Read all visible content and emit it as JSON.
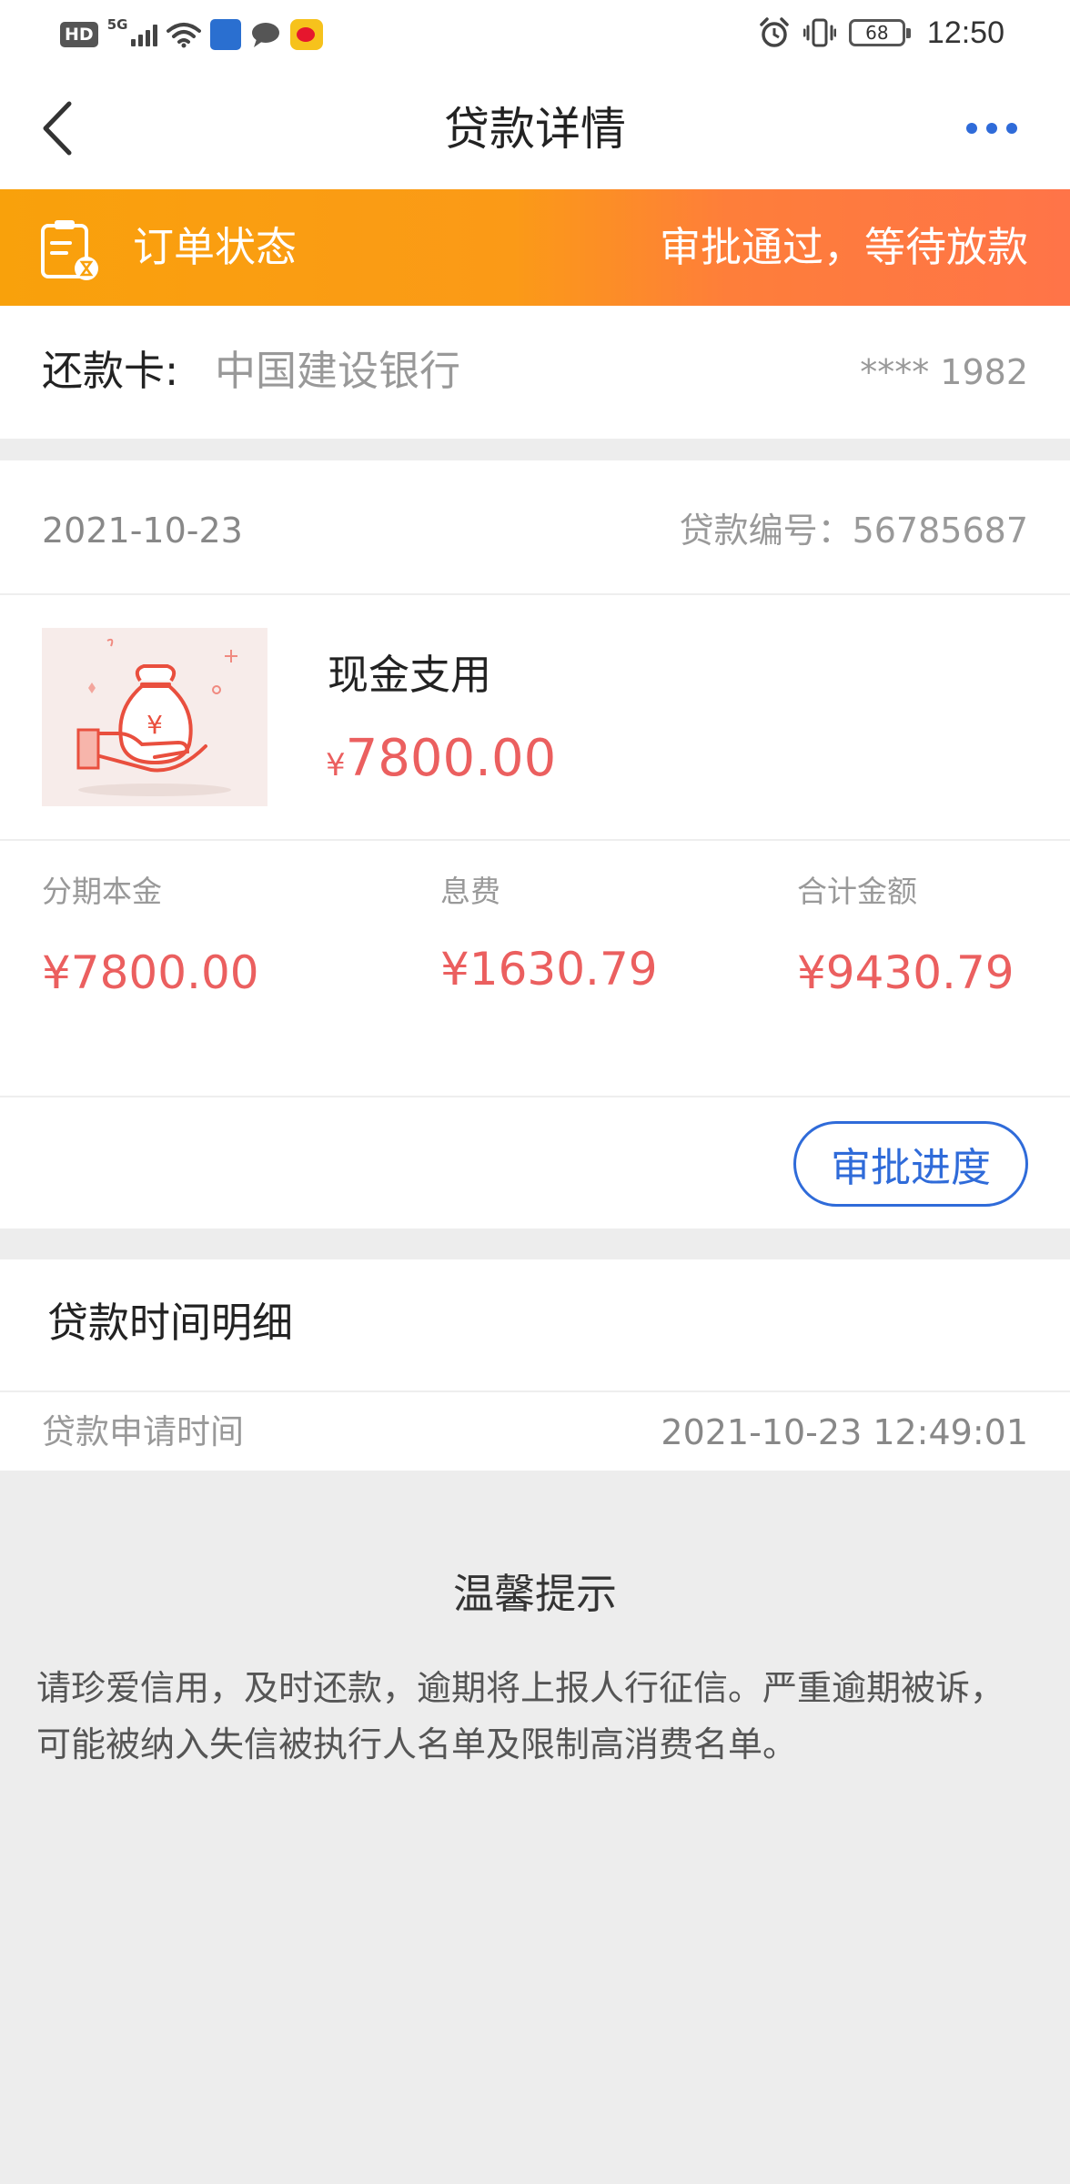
{
  "status_bar": {
    "hd": "HD",
    "network": "5G",
    "battery": "68",
    "time": "12:50"
  },
  "nav": {
    "title": "贷款详情"
  },
  "order_status": {
    "label": "订单状态",
    "status": "审批通过，等待放款"
  },
  "repayment_card": {
    "label": "还款卡:",
    "bank": "中国建设银行",
    "card_number": "**** 1982"
  },
  "order": {
    "date": "2021-10-23",
    "loan_number": "贷款编号：56785687",
    "product_name": "现金支用",
    "currency": "¥",
    "amount": "7800.00",
    "principal_label": "分期本金",
    "principal_value": "¥7800.00",
    "fee_label": "息费",
    "fee_value": "¥1630.79",
    "total_label": "合计金额",
    "total_value": "¥9430.79",
    "progress_button": "审批进度"
  },
  "time_detail": {
    "title": "贷款时间明细",
    "apply_label": "贷款申请时间",
    "apply_time": "2021-10-23 12:49:01"
  },
  "tips": {
    "title": "温馨提示",
    "text": "请珍爱信用，及时还款，逾期将上报人行征信。严重逾期被诉，可能被纳入失信被执行人名单及限制高消费名单。"
  },
  "colors": {
    "accent_blue": "#2f6bd9",
    "amount_red": "#eb5f5f",
    "banner_orange": "#f9a10b",
    "banner_red": "#ff7448"
  }
}
